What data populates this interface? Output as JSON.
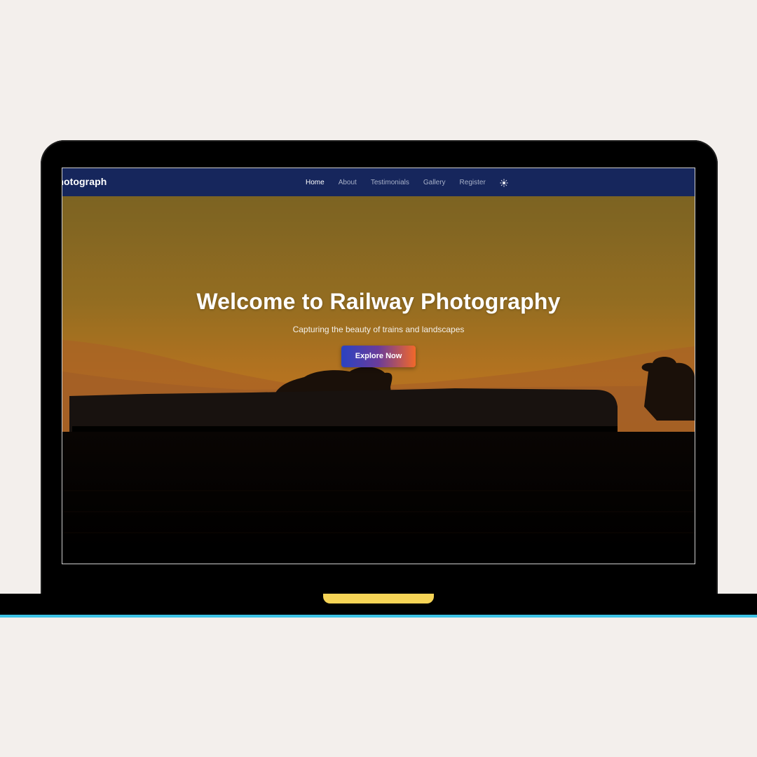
{
  "navbar": {
    "brand": "y Photograph",
    "links": [
      {
        "label": "Home",
        "active": true
      },
      {
        "label": "About",
        "active": false
      },
      {
        "label": "Testimonials",
        "active": false
      },
      {
        "label": "Gallery",
        "active": false
      },
      {
        "label": "Register",
        "active": false
      }
    ],
    "theme_toggle_icon": "sun-icon"
  },
  "hero": {
    "title": "Welcome to Railway Photography",
    "subtitle": "Capturing the beauty of trains and landscapes",
    "cta_label": "Explore Now",
    "background": "sunset train silhouette photo"
  },
  "colors": {
    "page_background": "#f3efec",
    "navbar": "#16265c",
    "sky_top": "#8a6a22",
    "sky_bottom": "#c77f22",
    "cta_gradient_start": "#2a43c2",
    "cta_gradient_end": "#f2682a",
    "laptop_accent": "#3cc3e6",
    "notch": "#f6d456"
  }
}
